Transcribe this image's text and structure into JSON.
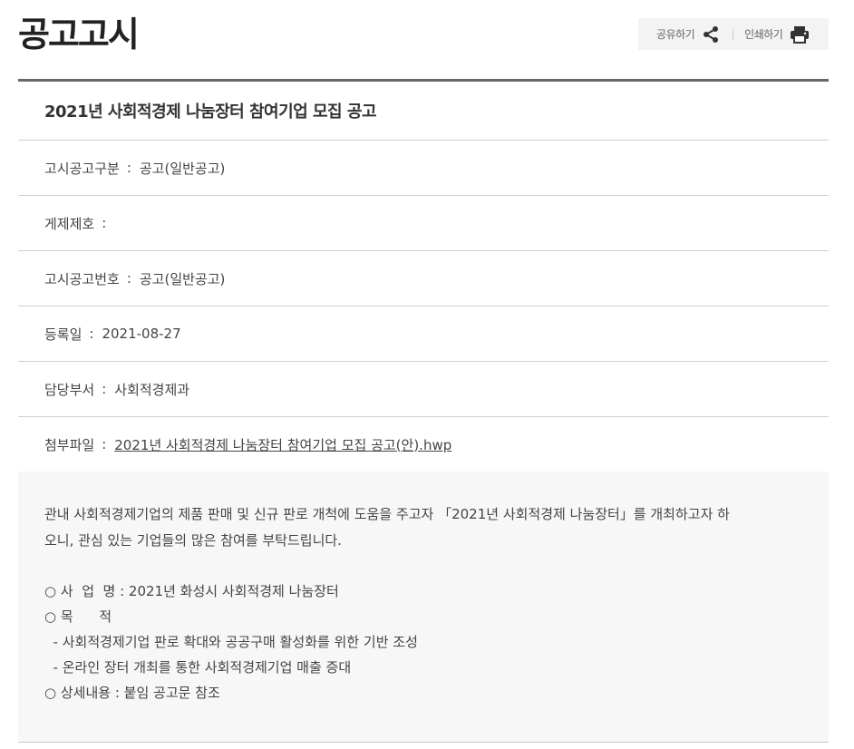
{
  "header": {
    "title": "공고고시",
    "share_label": "공유하기",
    "print_label": "인쇄하기",
    "share_icon": "share-icon",
    "print_icon": "printer-icon"
  },
  "notice": {
    "title": "2021년 사회적경제 나눔장터 참여기업 모집 공고",
    "fields": [
      {
        "label": "고시공고구분",
        "sep": ":",
        "value": "공고(일반공고)"
      },
      {
        "label": "게제제호",
        "sep": ":",
        "value": ""
      },
      {
        "label": "고시공고번호",
        "sep": ":",
        "value": "공고(일반공고)"
      },
      {
        "label": "등록일",
        "sep": ":",
        "value": "2021-08-27"
      },
      {
        "label": "담당부서",
        "sep": ":",
        "value": "사회적경제과"
      },
      {
        "label": "첨부파일",
        "sep": ":",
        "value": "2021년 사회적경제 나눔장터 참여기업 모집 공고(안).hwp"
      }
    ]
  },
  "content": {
    "paragraph_line1": "관내 사회적경제기업의 제품 판매 및 신규 판로 개척에 도움을 주고자 「2021년 사회적경제 나눔장터」를 개최하고자 하",
    "paragraph_line2": "오니, 관심 있는 기업들의 많은 참여를 부탁드립니다.",
    "items": [
      "○ 사  업  명 : 2021년 화성시 사회적경제 나눔장터",
      "○ 목      적",
      "  - 사회적경제기업 판로 확대와 공공구매 활성화를 위한 기반 조성",
      "  - 온라인 장터 개최를 통한 사회적경제기업 매출 증대",
      "○ 상세내용 : 붙임 공고문 참조"
    ]
  }
}
